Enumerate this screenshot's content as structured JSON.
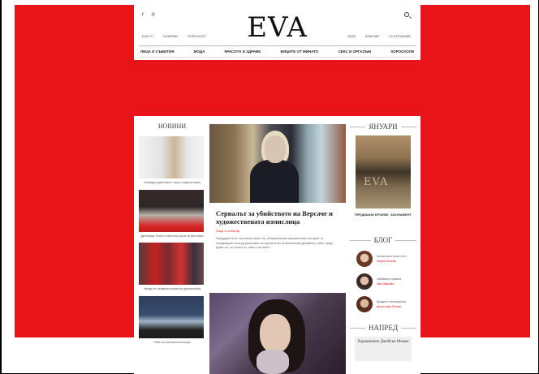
{
  "header": {
    "social": "f  ✆",
    "logo": "EVA",
    "top_links_left": [
      "EVA TV",
      "ГАЛЕРИИ",
      "ХОРОСКОП"
    ],
    "top_links_right": [
      "EKID",
      "АЛБУМИ",
      "СЪСТЕЗАНИЕ"
    ],
    "nav": [
      "ЛИЦА И СЪБИТИЯ",
      "МОДА",
      "КРАСОТА И ЗДРАВЕ",
      "ВИЦИТЕ ОТ МИНАТО",
      "СЕКС И ОРГАЗЪМ",
      "ХОРОСКОПИ"
    ]
  },
  "news": {
    "title": "НОВИНИ",
    "items": [
      {
        "caption": "Холивуд в дантелено: лица с ажурни визии"
      },
      {
        "caption": "Дженифър Лопес в пясъчна рокля за фестивал"
      },
      {
        "caption": "Звезди по червения килим на церемонията"
      },
      {
        "caption": "Ревю на есенната колекция"
      }
    ]
  },
  "main": {
    "headline": "Сериалът за убийството на Версаче и художествената измислица",
    "tag": "Лица и събития",
    "excerpt": "Продуцентите на новия сезон на „Американска криминална история“ в следващия епизод разказват историята на италианския дизайнер, убит пред дома си, но колко от това е истина?"
  },
  "sidebar": {
    "issue_title": "ЯНУАРИ",
    "cover_logo": "EVA",
    "cover_links": [
      "ПРЕДИШНИ БРОЕВЕ",
      "АБОНАМЕНТ"
    ],
    "blog_title": "БЛОГ",
    "blog_items": [
      {
        "text": "Косата ми и моят стил",
        "author": "Мария Илиева"
      },
      {
        "text": "Забавата в зимата",
        "author": "Ива Иванова"
      },
      {
        "text": "Брадите и колекцията",
        "author": "Десислава Тонева"
      }
    ],
    "next_title": "НАПРЕД",
    "next_text": "Хармоничен Джейсън Момоа"
  }
}
